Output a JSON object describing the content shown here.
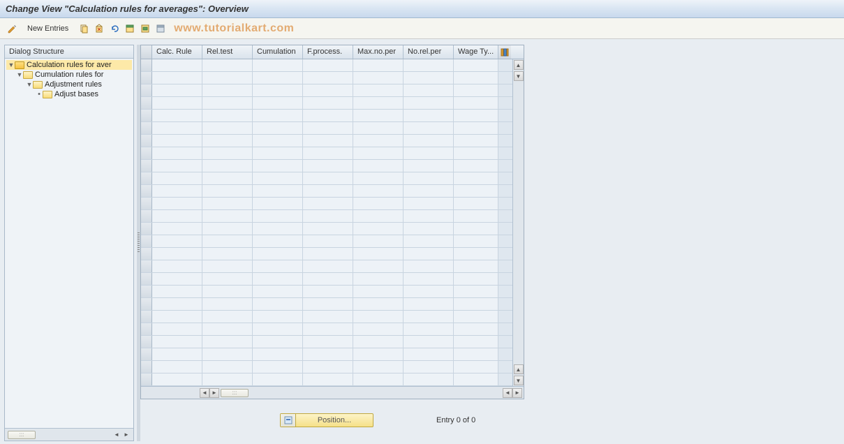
{
  "title": "Change View \"Calculation rules for averages\": Overview",
  "toolbar": {
    "new_entries_label": "New Entries"
  },
  "watermark": "www.tutorialkart.com",
  "tree": {
    "header": "Dialog Structure",
    "items": [
      {
        "label": "Calculation rules for aver",
        "level": 0,
        "open": true,
        "selected": true,
        "dot": false
      },
      {
        "label": "Cumulation rules for",
        "level": 1,
        "open": false,
        "selected": false,
        "dot": false
      },
      {
        "label": "Adjustment rules",
        "level": 2,
        "open": false,
        "selected": false,
        "dot": false
      },
      {
        "label": "Adjust bases",
        "level": 3,
        "open": false,
        "selected": false,
        "dot": true
      }
    ]
  },
  "grid": {
    "columns": {
      "calc_rule": "Calc. Rule",
      "rel_test": "Rel.test",
      "cumulation": "Cumulation",
      "f_process": "F.process.",
      "max_no_per": "Max.no.per",
      "no_rel_per": "No.rel.per",
      "wage_ty": "Wage Ty..."
    },
    "row_count": 26
  },
  "footer": {
    "position_label": "Position...",
    "entry_text": "Entry 0 of 0"
  }
}
